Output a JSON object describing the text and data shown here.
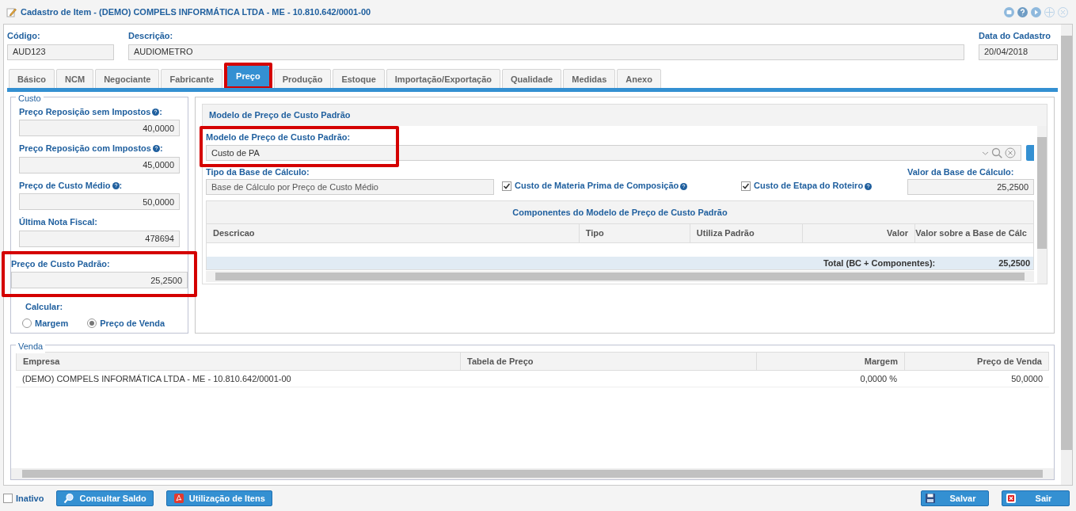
{
  "window": {
    "title": "Cadastro de Item - (DEMO) COMPELS INFORMÁTICA LTDA - ME - 10.810.642/0001-00"
  },
  "header_fields": [
    {
      "label": "Código:",
      "value": "AUD123"
    },
    {
      "label": "Descrição:",
      "value": "AUDIOMETRO"
    },
    {
      "label": "Data do Cadastro",
      "value": "20/04/2018"
    }
  ],
  "tabs": [
    {
      "label": "Básico",
      "selected": false,
      "highlighted": false
    },
    {
      "label": "NCM",
      "selected": false,
      "highlighted": false
    },
    {
      "label": "Negociante",
      "selected": false,
      "highlighted": false
    },
    {
      "label": "Fabricante",
      "selected": false,
      "highlighted": false
    },
    {
      "label": "Preço",
      "selected": true,
      "highlighted": true
    },
    {
      "label": "Produção",
      "selected": false,
      "highlighted": false
    },
    {
      "label": "Estoque",
      "selected": false,
      "highlighted": false
    },
    {
      "label": "Importação/Exportação",
      "selected": false,
      "highlighted": false
    },
    {
      "label": "Qualidade",
      "selected": false,
      "highlighted": false
    },
    {
      "label": "Medidas",
      "selected": false,
      "highlighted": false
    },
    {
      "label": "Anexo",
      "selected": false,
      "highlighted": false
    }
  ],
  "custo": {
    "legend": "Custo",
    "fields": [
      {
        "label": "Preço Reposição sem Impostos",
        "help": true,
        "suffix": ":",
        "value": "40,0000",
        "highlighted": false
      },
      {
        "label": "Preço Reposição com Impostos",
        "help": true,
        "suffix": ":",
        "value": "45,0000",
        "highlighted": false
      },
      {
        "label": "Preço de Custo Médio",
        "help": true,
        "suffix": ":",
        "value": "50,0000",
        "highlighted": false
      },
      {
        "label": "Última Nota Fiscal",
        "help": false,
        "suffix": ":",
        "value": "478694",
        "highlighted": false
      },
      {
        "label": "Preço de Custo Padrão",
        "help": false,
        "suffix": ":",
        "value": "25,2500",
        "highlighted": true
      }
    ],
    "calcular": {
      "label": "Calcular:",
      "options": [
        {
          "label": "Margem",
          "selected": false
        },
        {
          "label": "Preço de Venda",
          "selected": true
        }
      ]
    }
  },
  "modelo": {
    "title": "Modelo de Preço de Custo Padrão",
    "model_field": {
      "label": "Modelo de Preço de Custo Padrão:",
      "value": "Custo de PA",
      "highlighted": true
    },
    "base_field": {
      "label": "Tipo da Base de Cálculo:",
      "value": "Base de Cálculo por Preço de Custo Médio"
    },
    "checkboxes": [
      {
        "label": "Custo de Materia Prima de Composição",
        "checked": true
      },
      {
        "label": "Custo de Etapa do Roteiro",
        "checked": true
      }
    ],
    "valor_field": {
      "label": "Valor da Base de Cálculo:",
      "value": "25,2500"
    },
    "components": {
      "title": "Componentes do Modelo de Preço de Custo Padrão",
      "columns": [
        "Descricao",
        "Tipo",
        "Utiliza Padrão",
        "Valor",
        "Valor sobre a Base de Cálc"
      ],
      "total_label": "Total (BC + Componentes):",
      "total_value": "25,2500"
    }
  },
  "venda": {
    "legend": "Venda",
    "columns": [
      "Empresa",
      "Tabela de Preço",
      "Margem",
      "Preço de Venda"
    ],
    "rows": [
      [
        "(DEMO) COMPELS INFORMÁTICA LTDA - ME - 10.810.642/0001-00",
        "",
        "0,0000 %",
        "50,0000"
      ]
    ]
  },
  "footer": {
    "inativo": {
      "label": "Inativo",
      "checked": false
    },
    "buttons": [
      {
        "label": "Consultar Saldo"
      },
      {
        "label": "Utilização de Itens"
      }
    ],
    "actions": [
      {
        "label": "Salvar"
      },
      {
        "label": "Sair"
      }
    ]
  }
}
